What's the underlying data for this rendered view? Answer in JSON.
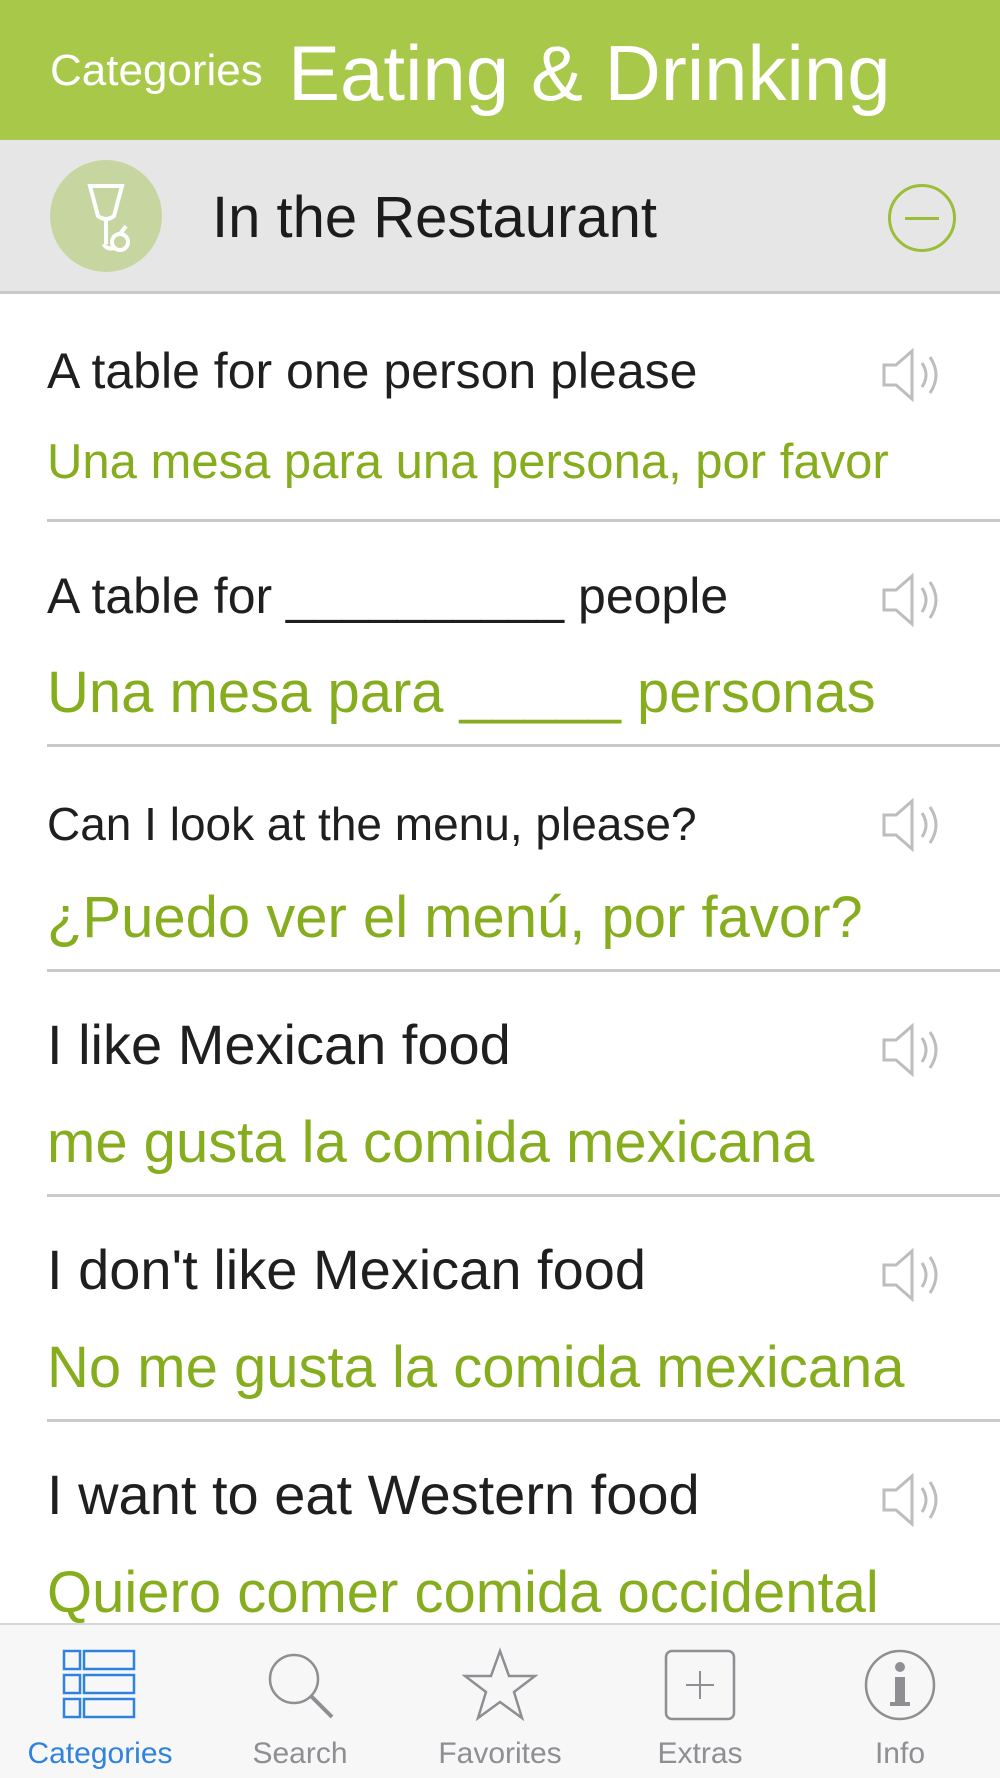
{
  "nav": {
    "back_label": "Categories",
    "title": "Eating & Drinking"
  },
  "section": {
    "icon": "wine-glass-icon",
    "title": "In the Restaurant",
    "action_icon": "collapse-minus-icon"
  },
  "phrases": [
    {
      "english": "A table for one person please",
      "spanish": "Una mesa para una persona, por favor"
    },
    {
      "english": "A table for __________ people",
      "spanish": "Una mesa para _____ personas"
    },
    {
      "english": "Can I look at the menu, please?",
      "spanish": "¿Puedo ver el menú, por favor?"
    },
    {
      "english": "I like Mexican food",
      "spanish": "me gusta la comida mexicana"
    },
    {
      "english": "I don't like Mexican food",
      "spanish": "No me gusta la comida mexicana"
    },
    {
      "english": "I want to eat Western food",
      "spanish": "Quiero comer comida occidental"
    }
  ],
  "tabbar": {
    "tabs": [
      {
        "label": "Categories",
        "icon": "list-grid-icon",
        "active": true
      },
      {
        "label": "Search",
        "icon": "magnifier-icon",
        "active": false
      },
      {
        "label": "Favorites",
        "icon": "star-icon",
        "active": false
      },
      {
        "label": "Extras",
        "icon": "plus-square-icon",
        "active": false
      },
      {
        "label": "Info",
        "icon": "info-icon",
        "active": false
      }
    ]
  },
  "colors": {
    "nav_background": "#a8c84a",
    "spanish_text": "#86ad1e",
    "active_tab": "#2f83de",
    "inactive_tab": "#8e8e93"
  }
}
